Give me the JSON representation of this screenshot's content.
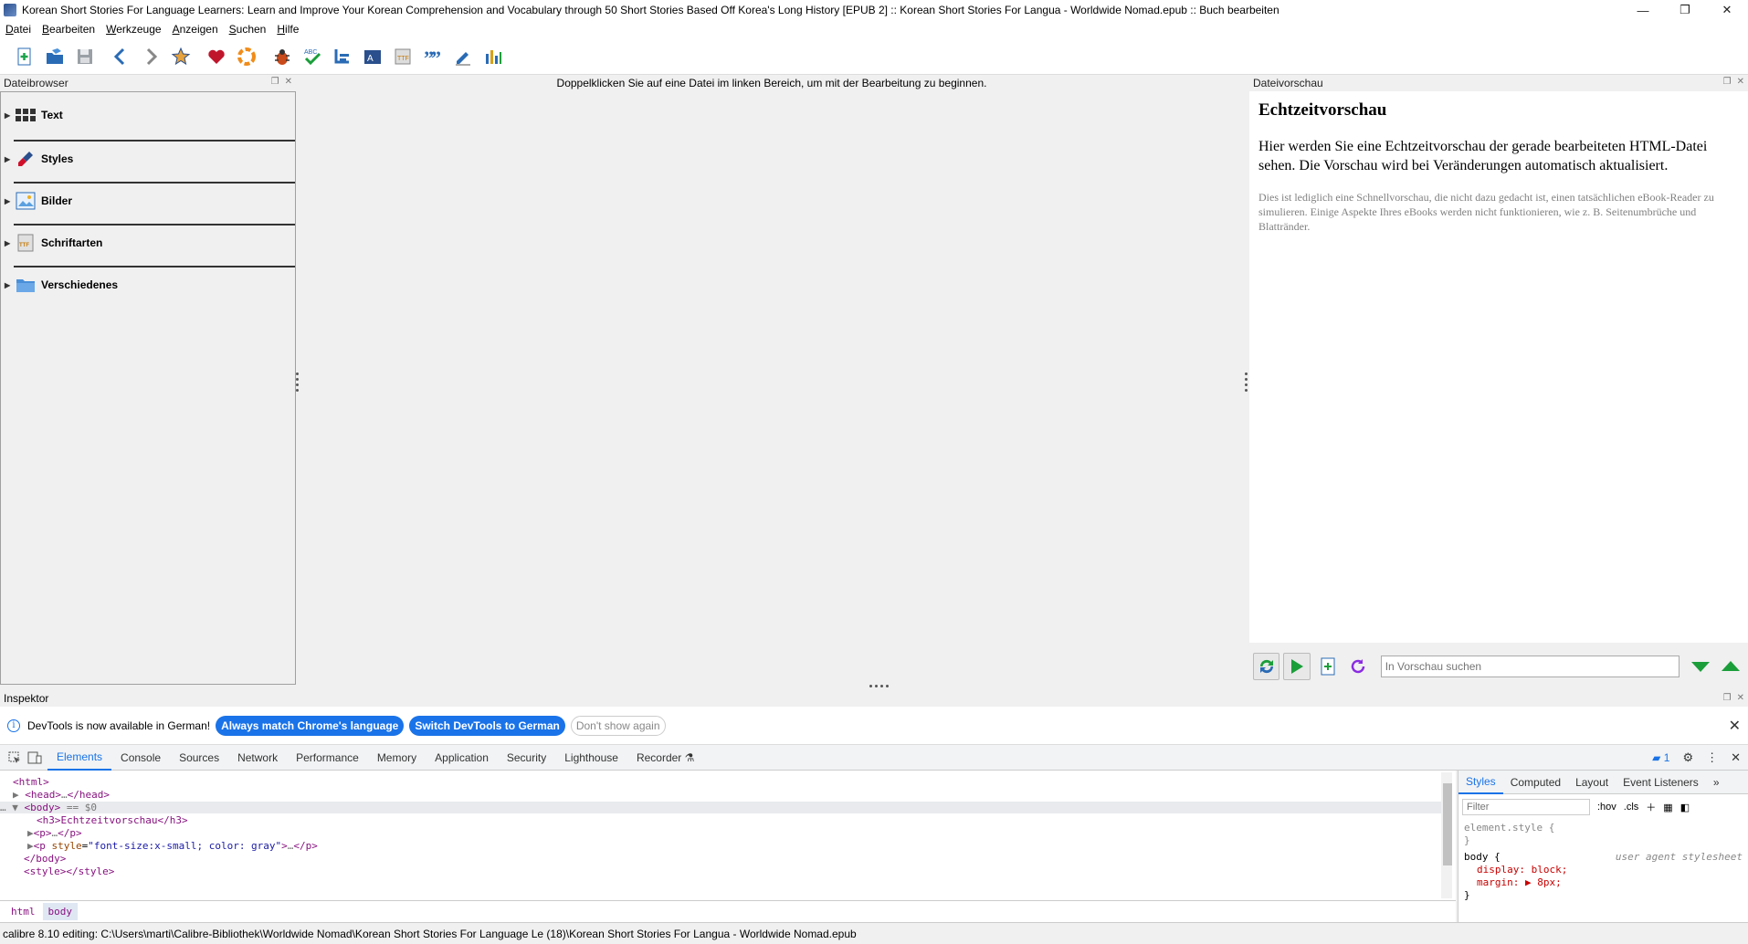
{
  "window": {
    "title": "Korean Short Stories For Language Learners: Learn and Improve Your Korean Comprehension and Vocabulary through 50 Short Stories Based Off Korea's Long History [EPUB 2] :: Korean Short Stories For Langua - Worldwide Nomad.epub :: Buch bearbeiten",
    "controls": {
      "minimize": "—",
      "maximize": "❐",
      "close": "✕"
    }
  },
  "menu": [
    "Datei",
    "Bearbeiten",
    "Werkzeuge",
    "Anzeigen",
    "Suchen",
    "Hilfe"
  ],
  "toolbar": {
    "icons": [
      "new-file-icon",
      "open-book-icon",
      "save-icon",
      "back-icon",
      "forward-icon",
      "checkpoint-icon",
      "donate-heart-icon",
      "help-icon",
      "check-book-icon",
      "spellcheck-icon",
      "reports-icon",
      "table-of-contents-icon",
      "fonts-icon",
      "quote-icon",
      "edit-icon",
      "reports-chart-icon"
    ]
  },
  "filebrowser": {
    "title": "Dateibrowser",
    "items": [
      {
        "label": "Text",
        "icon": "text-files-icon"
      },
      {
        "label": "Styles",
        "icon": "styles-brush-icon"
      },
      {
        "label": "Bilder",
        "icon": "images-icon"
      },
      {
        "label": "Schriftarten",
        "icon": "fonts-file-icon"
      },
      {
        "label": "Verschiedenes",
        "icon": "misc-folder-icon"
      }
    ]
  },
  "editor": {
    "hint": "Doppelklicken Sie auf eine Datei im linken Bereich, um mit der Bearbeitung zu beginnen."
  },
  "preview": {
    "title": "Dateivorschau",
    "heading": "Echtzeitvorschau",
    "paragraph": "Hier werden Sie eine Echtzeitvorschau der gerade bearbeiteten HTML-Datei sehen. Die Vorschau wird bei Veränderungen automatisch aktualisiert.",
    "note": "Dies ist lediglich eine Schnellvorschau, die nicht dazu gedacht ist, einen tatsächlichen eBook-Reader zu simulieren. Einige Aspekte Ihres eBooks werden nicht funktionieren, wie z. B. Seitenumbrüche und Blattränder.",
    "search_placeholder": "In Vorschau suchen"
  },
  "inspector": {
    "title": "Inspektor",
    "infobar": {
      "message": "DevTools is now available in German!",
      "btn_match": "Always match Chrome's language",
      "btn_switch": "Switch DevTools to German",
      "btn_dismiss": "Don't show again"
    },
    "tabs": [
      "Elements",
      "Console",
      "Sources",
      "Network",
      "Performance",
      "Memory",
      "Application",
      "Security",
      "Lighthouse",
      "Recorder"
    ],
    "active_tab": "Elements",
    "messages_count": "1",
    "dom": {
      "l1": "<html>",
      "l2_open": "<head>",
      "l2_close": "</head>",
      "l3_open": "<body>",
      "l3_eq": "== $0",
      "l4": "<h3>Echtzeitvorschau</h3>",
      "l5_open": "<p>",
      "l5_close": "</p>",
      "l6_tag": "<p ",
      "l6_attr": "style",
      "l6_val": "\"font-size:x-small; color: gray\"",
      "l6_end": ">",
      "l6_close": "</p>",
      "l7": "</body>",
      "l8": "<style></style>"
    },
    "breadcrumbs": [
      "html",
      "body"
    ],
    "styles": {
      "tabs": [
        "Styles",
        "Computed",
        "Layout",
        "Event Listeners"
      ],
      "filter_placeholder": "Filter",
      "hov": ":hov",
      "cls": ".cls",
      "rule1": "element.style {",
      "rule1_end": "}",
      "rule2_sel": "body {",
      "rule2_src": "user agent stylesheet",
      "rule2_p1": "display: block;",
      "rule2_p2": "margin: ▶ 8px;",
      "rule2_end": "}"
    }
  },
  "statusbar": "calibre 8.10 editing: C:\\Users\\marti\\Calibre-Bibliothek\\Worldwide Nomad\\Korean Short Stories For Language Le (18)\\Korean Short Stories For Langua - Worldwide Nomad.epub"
}
